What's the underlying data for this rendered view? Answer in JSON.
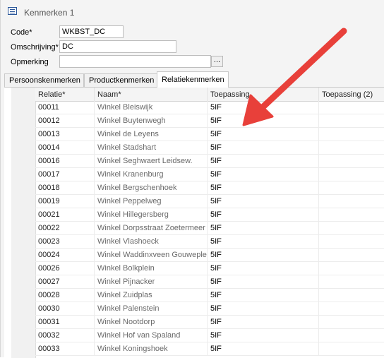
{
  "window": {
    "title": "Kenmerken 1"
  },
  "form": {
    "code_label": "Code*",
    "code_value": "WKBST_DC",
    "omschrijving_label": "Omschrijving*",
    "omschrijving_value": "DC",
    "opmerking_label": "Opmerking",
    "opmerking_value": "",
    "browse_label": "..."
  },
  "tabs": [
    {
      "label": "Persoonskenmerken",
      "active": false
    },
    {
      "label": "Productkenmerken",
      "active": false
    },
    {
      "label": "Relatiekenmerken",
      "active": true
    }
  ],
  "grid": {
    "columns": [
      "Relatie*",
      "Naam*",
      "Toepassing",
      "Toepassing (2)"
    ],
    "rows": [
      {
        "relatie": "00011",
        "naam": "Winkel Bleiswijk",
        "toepassing": "5IF",
        "toepassing2": ""
      },
      {
        "relatie": "00012",
        "naam": "Winkel Buytenwegh",
        "toepassing": "5IF",
        "toepassing2": ""
      },
      {
        "relatie": "00013",
        "naam": "Winkel de Leyens",
        "toepassing": "5IF",
        "toepassing2": ""
      },
      {
        "relatie": "00014",
        "naam": "Winkel Stadshart",
        "toepassing": "5IF",
        "toepassing2": ""
      },
      {
        "relatie": "00016",
        "naam": "Winkel Seghwaert Leidsew.",
        "toepassing": "5IF",
        "toepassing2": ""
      },
      {
        "relatie": "00017",
        "naam": "Winkel Kranenburg",
        "toepassing": "5IF",
        "toepassing2": ""
      },
      {
        "relatie": "00018",
        "naam": "Winkel Bergschenhoek",
        "toepassing": "5IF",
        "toepassing2": ""
      },
      {
        "relatie": "00019",
        "naam": "Winkel Peppelweg",
        "toepassing": "5IF",
        "toepassing2": ""
      },
      {
        "relatie": "00021",
        "naam": "Winkel Hillegersberg",
        "toepassing": "5IF",
        "toepassing2": ""
      },
      {
        "relatie": "00022",
        "naam": "Winkel Dorpsstraat Zoetermeer",
        "toepassing": "5IF",
        "toepassing2": ""
      },
      {
        "relatie": "00023",
        "naam": "Winkel Vlashoeck",
        "toepassing": "5IF",
        "toepassing2": ""
      },
      {
        "relatie": "00024",
        "naam": "Winkel Waddinxveen Gouweplein",
        "toepassing": "5IF",
        "toepassing2": ""
      },
      {
        "relatie": "00026",
        "naam": "Winkel Bolkplein",
        "toepassing": "5IF",
        "toepassing2": ""
      },
      {
        "relatie": "00027",
        "naam": "Winkel Pijnacker",
        "toepassing": "5IF",
        "toepassing2": ""
      },
      {
        "relatie": "00028",
        "naam": "Winkel Zuidplas",
        "toepassing": "5IF",
        "toepassing2": ""
      },
      {
        "relatie": "00030",
        "naam": "Winkel Palenstein",
        "toepassing": "5IF",
        "toepassing2": ""
      },
      {
        "relatie": "00031",
        "naam": "Winkel Nootdorp",
        "toepassing": "5IF",
        "toepassing2": ""
      },
      {
        "relatie": "00032",
        "naam": "Winkel Hof van Spaland",
        "toepassing": "5IF",
        "toepassing2": ""
      },
      {
        "relatie": "00033",
        "naam": "Winkel Koningshoek",
        "toepassing": "5IF",
        "toepassing2": ""
      }
    ]
  },
  "colors": {
    "arrow": "#e8403a",
    "title_icon": "#2b579a"
  },
  "icons": {
    "title": "form-list-icon",
    "annotation": "red-arrow-annotation"
  }
}
